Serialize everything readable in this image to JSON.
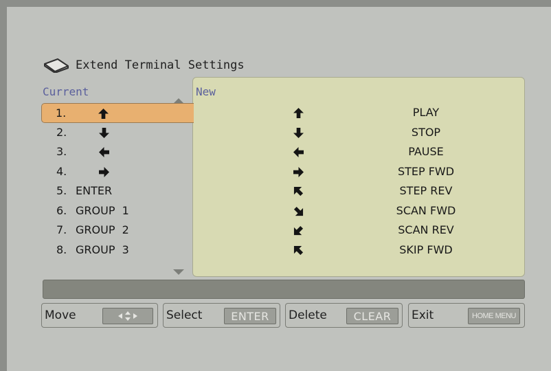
{
  "title": {
    "text": "Extend Terminal Settings",
    "icon": "remote-terminal-icon"
  },
  "current": {
    "header": "Current",
    "rows": [
      {
        "num": "1.",
        "label": "",
        "icon": "arrow-up-icon",
        "selected": true
      },
      {
        "num": "2.",
        "label": "",
        "icon": "arrow-down-icon",
        "selected": false
      },
      {
        "num": "3.",
        "label": "",
        "icon": "arrow-left-icon",
        "selected": false
      },
      {
        "num": "4.",
        "label": "",
        "icon": "arrow-right-icon",
        "selected": false
      },
      {
        "num": "5.",
        "label": "ENTER",
        "icon": "",
        "selected": false
      },
      {
        "num": "6.",
        "label": "GROUP  1",
        "icon": "",
        "selected": false
      },
      {
        "num": "7.",
        "label": "GROUP  2",
        "icon": "",
        "selected": false
      },
      {
        "num": "8.",
        "label": "GROUP  3",
        "icon": "",
        "selected": false
      }
    ]
  },
  "new": {
    "header": "New",
    "rows": [
      {
        "icon": "arrow-up-icon",
        "function": "PLAY"
      },
      {
        "icon": "arrow-down-icon",
        "function": "STOP"
      },
      {
        "icon": "arrow-left-icon",
        "function": "PAUSE"
      },
      {
        "icon": "arrow-right-icon",
        "function": "STEP FWD"
      },
      {
        "icon": "arrow-upleft-icon",
        "function": "STEP REV"
      },
      {
        "icon": "arrow-downright-icon",
        "function": "SCAN FWD"
      },
      {
        "icon": "arrow-downleft-icon",
        "function": "SCAN REV"
      },
      {
        "icon": "arrow-upleft-icon",
        "function": "SKIP FWD"
      }
    ]
  },
  "buttons": [
    {
      "label": "Move",
      "key": "",
      "key_icon": "dpad-icon"
    },
    {
      "label": "Select",
      "key": "ENTER"
    },
    {
      "label": "Delete",
      "key": "CLEAR"
    },
    {
      "label": "Exit",
      "key": "HOME MENU"
    }
  ],
  "colors": {
    "background": "#c0c2be",
    "selection": "#e8b070",
    "panel": "#d8dab3",
    "header_text": "#5a5f9c"
  }
}
